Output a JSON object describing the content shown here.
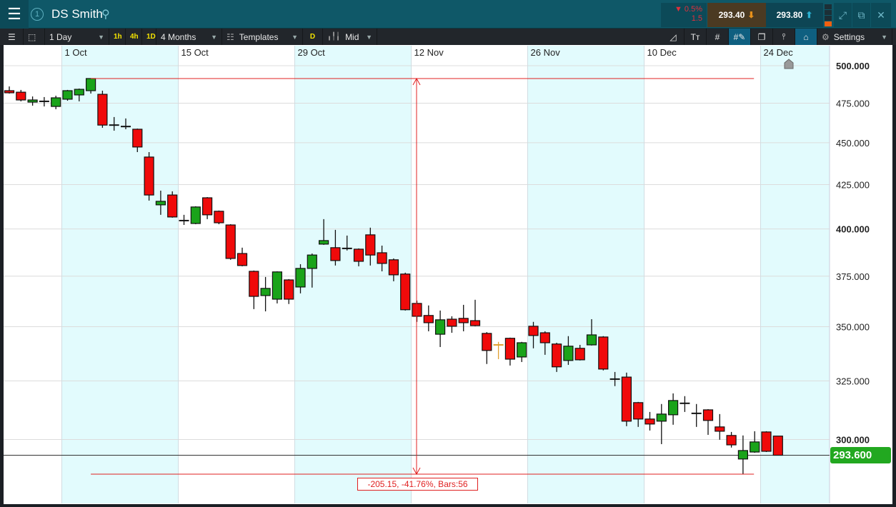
{
  "header": {
    "menu_icon": "hamburger-icon",
    "instance_number": "1",
    "title": "DS Smith",
    "search_icon": "search-icon",
    "change_pct": "▼ 0.5%",
    "change_abs": "1.5",
    "sell_price": "293.40",
    "buy_price": "293.80",
    "sell_arrow": "⬇",
    "buy_arrow": "⬆"
  },
  "toolbar": {
    "interval": "1 Day",
    "quick": [
      "1h",
      "4h",
      "1D"
    ],
    "range": "4 Months",
    "templates": "Templates",
    "d_label": "D",
    "price_type": "Mid",
    "settings": "Settings"
  },
  "colors": {
    "up": "#1aa31a",
    "down": "#f00a0a",
    "doji_special": "#e0a030",
    "measure": "#e02020",
    "band": "#e2fbfd",
    "current": "#22a820"
  },
  "chart_data": {
    "type": "candlestick",
    "yscale": "log",
    "price_ticks": [
      500,
      475,
      450,
      425,
      400,
      375,
      350,
      325,
      300
    ],
    "price_tick_labels": [
      "500.000",
      "475.000",
      "450.000",
      "425.000",
      "400.000",
      "375.000",
      "350.000",
      "325.000",
      "300.000"
    ],
    "date_ticks": [
      {
        "bar": 5,
        "label": "1 Oct"
      },
      {
        "bar": 15,
        "label": "15 Oct"
      },
      {
        "bar": 25,
        "label": "29 Oct"
      },
      {
        "bar": 35,
        "label": "12 Nov"
      },
      {
        "bar": 45,
        "label": "26 Nov"
      },
      {
        "bar": 55,
        "label": "10 Dec"
      },
      {
        "bar": 65,
        "label": "24 Dec"
      }
    ],
    "current_price": 293.6,
    "current_price_label": "293.600",
    "measure": {
      "from_bar": 7,
      "to_bar": 63,
      "from_price": 491.27,
      "to_price": 286.12,
      "label": "-205.15, -41.76%, Bars:56"
    },
    "ohlc": [
      [
        483.2,
        486.0,
        481.3,
        481.8
      ],
      [
        482.2,
        483.7,
        476.2,
        477.1
      ],
      [
        475.7,
        479.4,
        473.4,
        477.1
      ],
      [
        476.2,
        479.0,
        472.9,
        476.2
      ],
      [
        472.9,
        479.9,
        471.1,
        478.5
      ],
      [
        477.6,
        483.7,
        476.6,
        483.2
      ],
      [
        480.4,
        484.6,
        476.2,
        484.1
      ],
      [
        483.2,
        491.27,
        481.3,
        491.27
      ],
      [
        480.8,
        483.2,
        459.3,
        461.0
      ],
      [
        461.0,
        466.1,
        457.5,
        461.0
      ],
      [
        460.1,
        465.2,
        458.4,
        460.1
      ],
      [
        458.4,
        458.8,
        444.3,
        447.4
      ],
      [
        441.3,
        444.3,
        415.8,
        419.0
      ],
      [
        413.4,
        421.5,
        407.8,
        415.4
      ],
      [
        419.0,
        421.1,
        406.2,
        406.6
      ],
      [
        404.6,
        407.8,
        402.2,
        404.6
      ],
      [
        403.0,
        412.6,
        402.6,
        412.2
      ],
      [
        417.4,
        417.8,
        405.4,
        407.8
      ],
      [
        409.8,
        410.2,
        402.6,
        403.4
      ],
      [
        402.2,
        402.6,
        383.5,
        384.2
      ],
      [
        386.8,
        389.9,
        380.1,
        380.5
      ],
      [
        377.5,
        377.9,
        358.5,
        364.8
      ],
      [
        365.2,
        374.6,
        357.4,
        368.8
      ],
      [
        363.4,
        377.5,
        361.3,
        377.2
      ],
      [
        373.1,
        373.5,
        361.0,
        363.4
      ],
      [
        369.5,
        381.2,
        366.3,
        379.0
      ],
      [
        379.0,
        386.8,
        369.2,
        386.0
      ],
      [
        391.8,
        405.4,
        391.4,
        393.7
      ],
      [
        389.9,
        399.5,
        380.5,
        383.1
      ],
      [
        389.5,
        396.4,
        388.4,
        389.5
      ],
      [
        389.1,
        389.5,
        380.1,
        382.7
      ],
      [
        396.8,
        400.7,
        380.5,
        386.0
      ],
      [
        387.2,
        391.0,
        377.5,
        381.6
      ],
      [
        383.5,
        384.2,
        372.4,
        375.7
      ],
      [
        376.1,
        376.8,
        357.8,
        358.2
      ],
      [
        361.3,
        362.7,
        352.3,
        355.0
      ],
      [
        355.4,
        360.3,
        347.8,
        351.9
      ],
      [
        346.4,
        357.8,
        340.4,
        353.3
      ],
      [
        353.6,
        355.0,
        347.1,
        350.2
      ],
      [
        354.0,
        360.6,
        347.8,
        351.9
      ],
      [
        352.9,
        363.1,
        350.2,
        350.5
      ],
      [
        346.8,
        347.4,
        332.6,
        338.8
      ],
      [
        341.4,
        342.8,
        334.8,
        341.4
      ],
      [
        344.5,
        344.8,
        331.9,
        334.8
      ],
      [
        335.8,
        342.8,
        333.5,
        342.4
      ],
      [
        350.2,
        352.3,
        339.8,
        345.8
      ],
      [
        347.1,
        347.8,
        336.8,
        342.4
      ],
      [
        341.8,
        342.4,
        329.0,
        331.3
      ],
      [
        334.2,
        345.5,
        332.2,
        340.8
      ],
      [
        339.8,
        341.4,
        334.2,
        334.5
      ],
      [
        341.4,
        353.6,
        341.1,
        346.1
      ],
      [
        345.1,
        345.5,
        329.7,
        330.3
      ],
      [
        325.8,
        329.0,
        322.7,
        325.8
      ],
      [
        326.7,
        328.7,
        305.5,
        307.6
      ],
      [
        315.5,
        315.8,
        305.2,
        308.5
      ],
      [
        308.5,
        311.5,
        303.7,
        306.4
      ],
      [
        307.6,
        314.9,
        298.1,
        310.6
      ],
      [
        310.3,
        319.5,
        306.1,
        316.4
      ],
      [
        315.2,
        318.3,
        311.5,
        315.2
      ],
      [
        310.9,
        314.9,
        305.2,
        310.9
      ],
      [
        312.4,
        312.7,
        301.9,
        307.9
      ],
      [
        305.2,
        310.6,
        299.9,
        303.4
      ],
      [
        301.65,
        303.1,
        296.7,
        297.8
      ],
      [
        292.1,
        301.65,
        286.12,
        295.5
      ],
      [
        294.9,
        303.4,
        294.6,
        299.0
      ],
      [
        303.1,
        303.4,
        294.9,
        295.2
      ],
      [
        301.4,
        301.4,
        293.6,
        293.6
      ]
    ]
  }
}
